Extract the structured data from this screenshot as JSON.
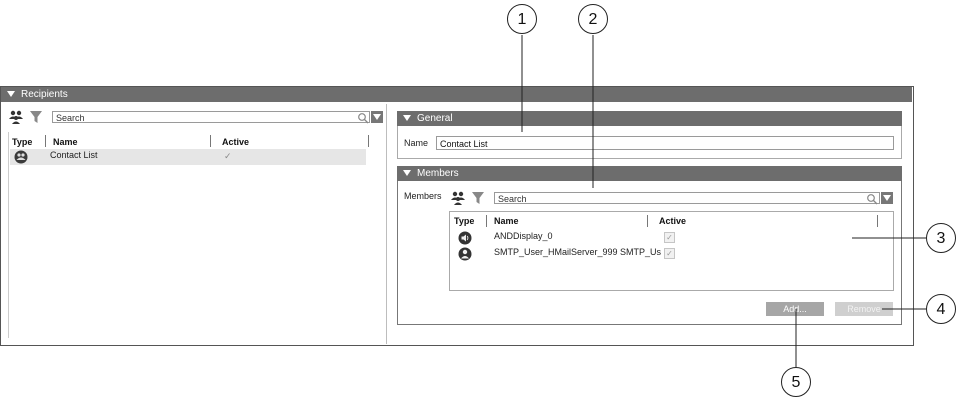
{
  "recipients": {
    "header": "Recipients",
    "search_placeholder": "Search",
    "columns": [
      "Type",
      "Name",
      "Active"
    ],
    "rows": [
      {
        "name": "Contact List",
        "active": "✓"
      }
    ]
  },
  "general": {
    "header": "General",
    "name_label": "Name",
    "name_value": "Contact List"
  },
  "members": {
    "header": "Members",
    "label": "Members",
    "search_placeholder": "Search",
    "columns": [
      "Type",
      "Name",
      "Active"
    ],
    "rows": [
      {
        "name": "ANDDisplay_0",
        "active": "✓"
      },
      {
        "name": "SMTP_User_HMailServer_999 SMTP_Us",
        "active": "✓"
      }
    ],
    "add_label": "Add...",
    "remove_label": "Remove"
  },
  "callouts": [
    "1",
    "2",
    "3",
    "4",
    "5"
  ],
  "icons": {
    "people": "group-icon",
    "filter": "filter-icon",
    "search": "magnifier-icon",
    "dropdown": "triangle-down-icon",
    "speaker": "speaker-icon",
    "user": "user-icon"
  },
  "colors": {
    "header_bg": "#6d6d6d",
    "button_bg": "#a6a6a6",
    "button_disabled_bg": "#cfcfcf",
    "selected_row_bg": "#e6e6e6"
  }
}
